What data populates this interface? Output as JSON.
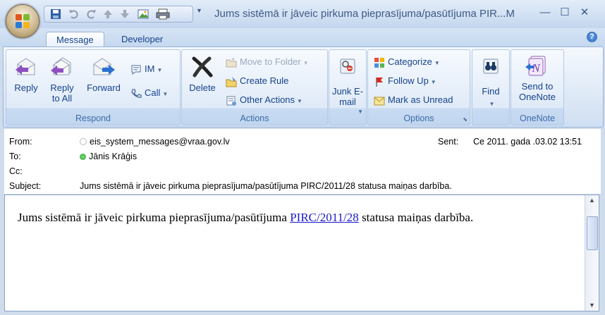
{
  "window": {
    "title": "Jums sistēmā ir jāveic pirkuma pieprasījuma/pasūtījuma PIR...M",
    "minimize": "—",
    "maximize": "☐",
    "close": "✕"
  },
  "tabs": [
    {
      "label": "Message"
    },
    {
      "label": "Developer"
    }
  ],
  "help": "?",
  "ribbon": {
    "respond": {
      "label": "Respond",
      "reply": "Reply",
      "reply_all": "Reply to All",
      "forward": "Forward",
      "im": "IM",
      "call": "Call"
    },
    "actions": {
      "label": "Actions",
      "delete": "Delete",
      "move_to_folder": "Move to Folder",
      "create_rule": "Create Rule",
      "other_actions": "Other Actions"
    },
    "junk": {
      "label": "Junk E-mail"
    },
    "options": {
      "label": "Options",
      "categorize": "Categorize",
      "follow_up": "Follow Up",
      "mark_as_unread": "Mark as Unread"
    },
    "find": {
      "label": "Find"
    },
    "onenote": {
      "label": "OneNote",
      "send": "Send to OneNote"
    }
  },
  "header": {
    "from_label": "From:",
    "from_value": "eis_system_messages@vraa.gov.lv",
    "to_label": "To:",
    "to_value": "Jānis Krāģis",
    "cc_label": "Cc:",
    "subject_label": "Subject:",
    "subject_value": "Jums sistēmā ir jāveic pirkuma pieprasījuma/pasūtījuma PIRC/2011/28  statusa maiņas darbība.",
    "sent_label": "Sent:",
    "sent_value": "Ce 2011.  gada .03.02 13:51"
  },
  "body": {
    "text_before": "Jums sistēmā ir jāveic pirkuma pieprasījuma/pasūtījuma ",
    "link": "PIRC/2011/28",
    "text_after": " statusa maiņas darbība."
  },
  "colors": {
    "accent": "#15428b",
    "presence_online": "#3bb63b"
  }
}
